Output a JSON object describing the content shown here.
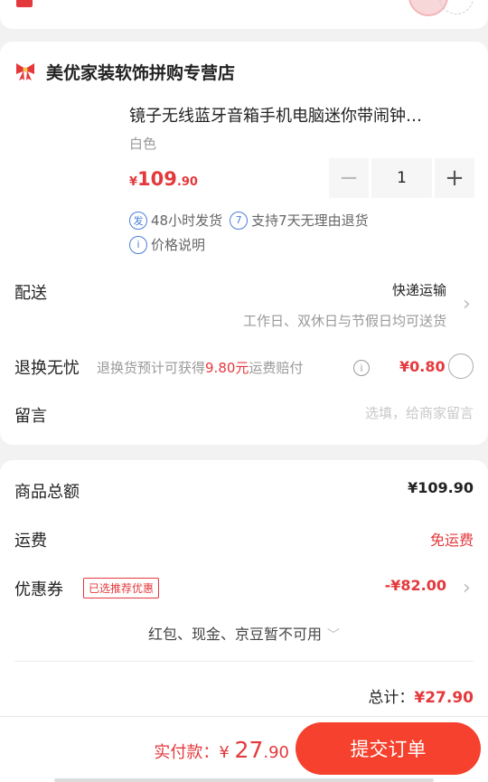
{
  "header": {
    "clipped_title": "",
    "clipped_sub": ""
  },
  "shop": {
    "name": "美优家装软饰拼购专营店",
    "icon": "bow-icon"
  },
  "product": {
    "title": "镜子无线蓝牙音箱手机电脑迷你带闹钟…",
    "spec": "白色",
    "price": {
      "currency": "¥",
      "integer": "109",
      "decimal": ".90"
    },
    "quantity": "1",
    "minus": "−",
    "plus": "+",
    "services": [
      {
        "badge": "发",
        "text": "48小时发货"
      },
      {
        "badge": "7",
        "text": "支持7天无理由退货"
      },
      {
        "badge": "i",
        "text": "价格说明"
      }
    ]
  },
  "delivery": {
    "label": "配送",
    "value": "快递运输",
    "sub": "工作日、双休日与节假日均可送货"
  },
  "refund": {
    "label": "退换无忧",
    "desc_prefix": "退换货预计可获得",
    "desc_amount": "9.80元",
    "desc_suffix": "运费赔付",
    "info": "i",
    "price": "¥0.80"
  },
  "note": {
    "label": "留言",
    "placeholder": "选填，给商家留言"
  },
  "summary": {
    "goods_label": "商品总额",
    "goods_value": "¥109.90",
    "shipping_label": "运费",
    "shipping_value": "免运费",
    "coupon_label": "优惠券",
    "coupon_tag": "已选推荐优惠",
    "coupon_value": "-¥82.00",
    "unavailable": "红包、现金、京豆暂不可用",
    "total_label": "总计：",
    "total_value": "¥27.90"
  },
  "bottom": {
    "pay_label": "实付款：¥ ",
    "pay_int": "27",
    "pay_dec": ".90",
    "submit": "提交订单"
  },
  "colors": {
    "accent": "#e4393c",
    "submit_bg": "#f5412d",
    "service_blue": "#4b7fd6"
  }
}
